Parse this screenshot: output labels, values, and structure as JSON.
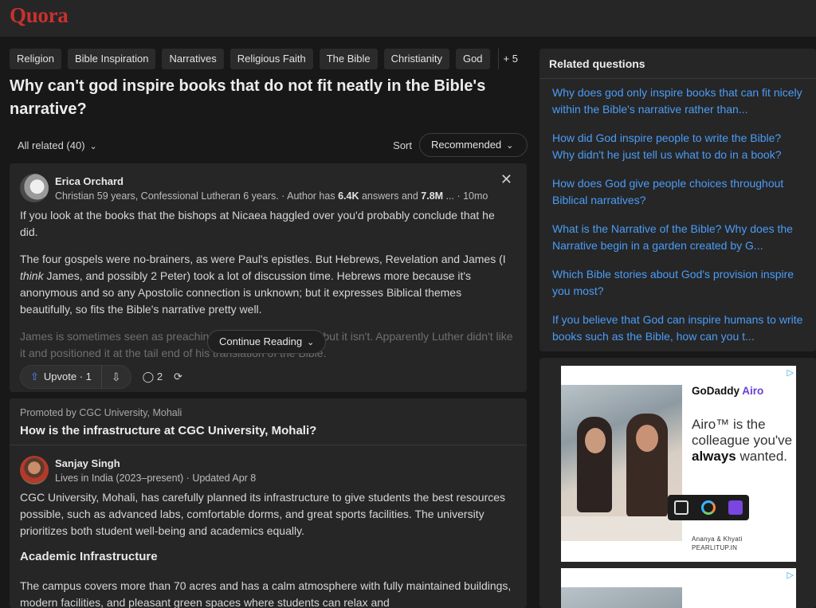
{
  "header": {
    "logo": "Quora"
  },
  "tags": [
    "Religion",
    "Bible Inspiration",
    "Narratives",
    "Religious Faith",
    "The Bible",
    "Christianity",
    "God"
  ],
  "tags_more": "+ 5",
  "question": "Why can't god inspire books that do not fit neatly in the Bible's narrative?",
  "sortbar": {
    "all_related": "All related (40)",
    "sort_label": "Sort",
    "sort_value": "Recommended"
  },
  "answer1": {
    "author": "Erica Orchard",
    "cred_prefix": "Christian 59 years, Confessional Lutheran 6 years. · Author has ",
    "answers_count": "6.4K",
    "cred_mid": " answers and ",
    "views_count": "7.8M",
    "cred_suffix": " ... · 10mo",
    "p1": "If you look at the books that the bishops at Nicaea haggled over you'd probably conclude that he did.",
    "p2a": "The four gospels were no-brainers, as were Paul's epistles. But Hebrews, Revelation and James (I ",
    "p2em": "think",
    "p2b": " James, and possibly 2 Peter) took a lot of discussion time. Hebrews more because it's anonymous and so any Apostolic connection is unknown; but it expresses Biblical themes beautifully, so fits the Bible's narrative pretty well.",
    "p3": "James is sometimes seen as preaching works righteousness but it isn't. Apparently Luther didn't like it and positioned it at the tail end of his translation of the Bible.",
    "continue_reading": "Continue Reading",
    "upvote_label": "Upvote · 1",
    "comments": "2"
  },
  "promo": {
    "promoted_by": "Promoted by CGC University, Mohali",
    "title": "How is the infrastructure at CGC University, Mohali?",
    "author": "Sanjay Singh",
    "cred": "Lives in India (2023–present) · Updated Apr 8",
    "p1": "CGC University, Mohali, has carefully planned its infrastructure to give students the best resources possible, such as advanced labs, comfortable dorms, and great sports facilities. The university prioritizes both student well-being and academics equally.",
    "heading": "Academic Infrastructure",
    "p2": "The campus covers more than 70 acres and has a calm atmosphere with fully maintained buildings, modern facilities, and pleasant green spaces where students can relax and"
  },
  "related": {
    "title": "Related questions",
    "items": [
      "Why does god only inspire books that can fit nicely within the Bible's narrative rather than...",
      "How did God inspire people to write the Bible? Why didn't he just tell us what to do in a book?",
      "How does God give people choices throughout Biblical narratives?",
      "What is the Narrative of the Bible? Why does the Narrative begin in a garden created by G...",
      "Which Bible stories about God's provision inspire you most?",
      "If you believe that God can inspire humans to write books such as the Bible, how can you t..."
    ]
  },
  "ad": {
    "brand": "GoDaddy",
    "brand_suffix": "Airo",
    "line1": "Airo™ is the colleague you've ",
    "line_bold": "always",
    "line2": " wanted.",
    "credit1": "Ananya & Khyati",
    "credit2": "PEARLITUP.IN"
  },
  "colors": {
    "brand": "#c8312f",
    "link": "#4b9cf7",
    "upvote": "#4f8cff",
    "airo": "#6a3fd6"
  }
}
